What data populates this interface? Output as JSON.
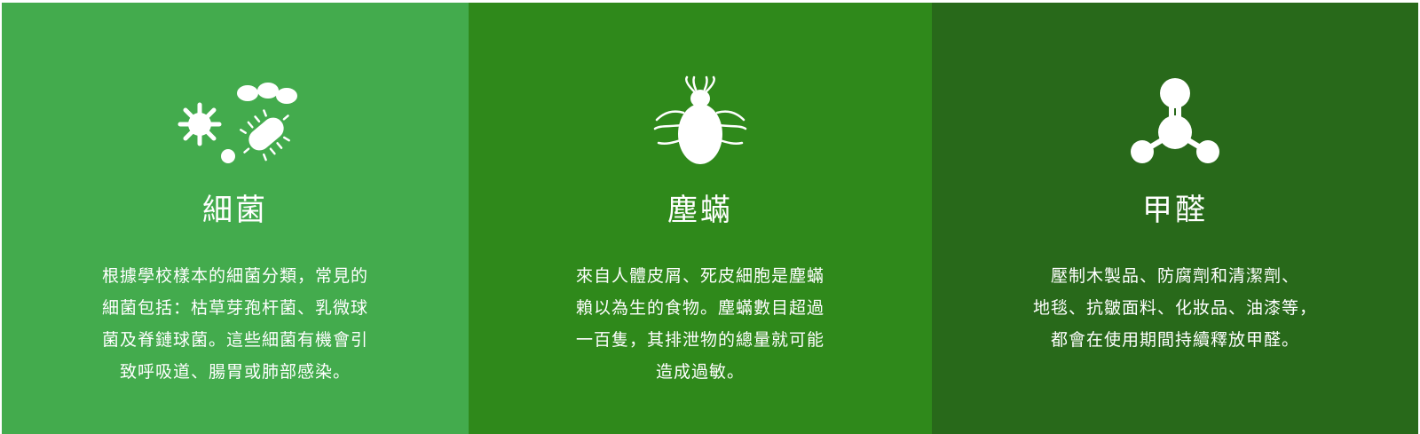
{
  "panels": [
    {
      "icon": "bacteria-icon",
      "color": "#43ab4d",
      "title": "細菌",
      "lines": [
        "根據學校樣本的細菌分類，常見的",
        "細菌包括：枯草芽孢杆菌、乳微球",
        "菌及脊鏈球菌。這些細菌有機會引",
        "致呼吸道、腸胃或肺部感染。"
      ]
    },
    {
      "icon": "dust-mite-icon",
      "color": "#2f891b",
      "title": "塵蟎",
      "lines": [
        "來自人體皮屑、死皮細胞是塵蟎",
        "賴以為生的食物。塵蟎數目超過",
        "一百隻，其排泄物的總量就可能",
        "造成過敏。"
      ]
    },
    {
      "icon": "molecule-icon",
      "color": "#28691a",
      "title": "甲醛",
      "lines": [
        "壓制木製品、防腐劑和清潔劑、",
        "地毯、抗皺面料、化妝品、油漆等，",
        "都會在使用期間持續釋放甲醛。"
      ]
    }
  ]
}
